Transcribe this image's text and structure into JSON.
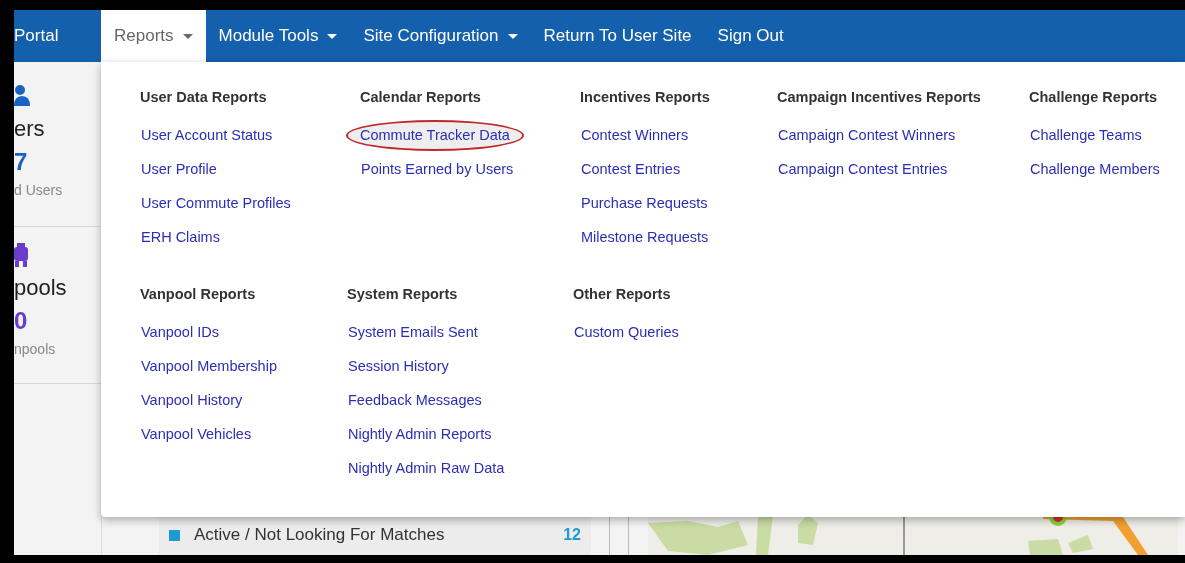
{
  "nav": {
    "items": [
      {
        "label": "Portal",
        "dropdown": false,
        "selected": false
      },
      {
        "label": "Reports",
        "dropdown": true,
        "selected": true
      },
      {
        "label": "Module Tools",
        "dropdown": true,
        "selected": false
      },
      {
        "label": "Site Configuration",
        "dropdown": true,
        "selected": false
      },
      {
        "label": "Return To User Site",
        "dropdown": false,
        "selected": false
      },
      {
        "label": "Sign Out",
        "dropdown": false,
        "selected": false
      }
    ]
  },
  "sidebar": {
    "cards": [
      {
        "title": "ers",
        "count": "7",
        "caption": "d Users",
        "color": "#1a63c4"
      },
      {
        "title": "pools",
        "count": "0",
        "caption": "npools",
        "color": "#6a3cc9"
      }
    ]
  },
  "reports_menu": {
    "rows": [
      {
        "groups": [
          {
            "heading": "User Data Reports",
            "links": [
              {
                "label": "User Account Status",
                "highlighted": false
              },
              {
                "label": "User Profile",
                "highlighted": false
              },
              {
                "label": "User Commute Profiles",
                "highlighted": false
              },
              {
                "label": "ERH Claims",
                "highlighted": false
              }
            ]
          },
          {
            "heading": "Calendar Reports",
            "links": [
              {
                "label": "Commute Tracker Data",
                "highlighted": true
              },
              {
                "label": "Points Earned by Users",
                "highlighted": false
              }
            ]
          },
          {
            "heading": "Incentives Reports",
            "links": [
              {
                "label": "Contest Winners",
                "highlighted": false
              },
              {
                "label": "Contest Entries",
                "highlighted": false
              },
              {
                "label": "Purchase Requests",
                "highlighted": false
              },
              {
                "label": "Milestone Requests",
                "highlighted": false
              }
            ]
          },
          {
            "heading": "Campaign Incentives Reports",
            "links": [
              {
                "label": "Campaign Contest Winners",
                "highlighted": false
              },
              {
                "label": "Campaign Contest Entries",
                "highlighted": false
              }
            ]
          },
          {
            "heading": "Challenge Reports",
            "links": [
              {
                "label": "Challenge Teams",
                "highlighted": false
              },
              {
                "label": "Challenge Members",
                "highlighted": false
              }
            ]
          }
        ]
      },
      {
        "groups": [
          {
            "heading": "Vanpool Reports",
            "links": [
              {
                "label": "Vanpool IDs",
                "highlighted": false
              },
              {
                "label": "Vanpool Membership",
                "highlighted": false
              },
              {
                "label": "Vanpool History",
                "highlighted": false
              },
              {
                "label": "Vanpool Vehicles",
                "highlighted": false
              }
            ]
          },
          {
            "heading": "System Reports",
            "links": [
              {
                "label": "System Emails Sent",
                "highlighted": false
              },
              {
                "label": "Session History",
                "highlighted": false
              },
              {
                "label": "Feedback Messages",
                "highlighted": false
              },
              {
                "label": "Nightly Admin Reports",
                "highlighted": false
              },
              {
                "label": "Nightly Admin Raw Data",
                "highlighted": false
              }
            ]
          },
          {
            "heading": "Other Reports",
            "links": [
              {
                "label": "Custom Queries",
                "highlighted": false
              }
            ]
          }
        ]
      }
    ]
  },
  "status_list": {
    "items": [
      {
        "label": "Active / Not Looking For Matches",
        "count": "12",
        "color": "#1e9ad6"
      }
    ]
  }
}
